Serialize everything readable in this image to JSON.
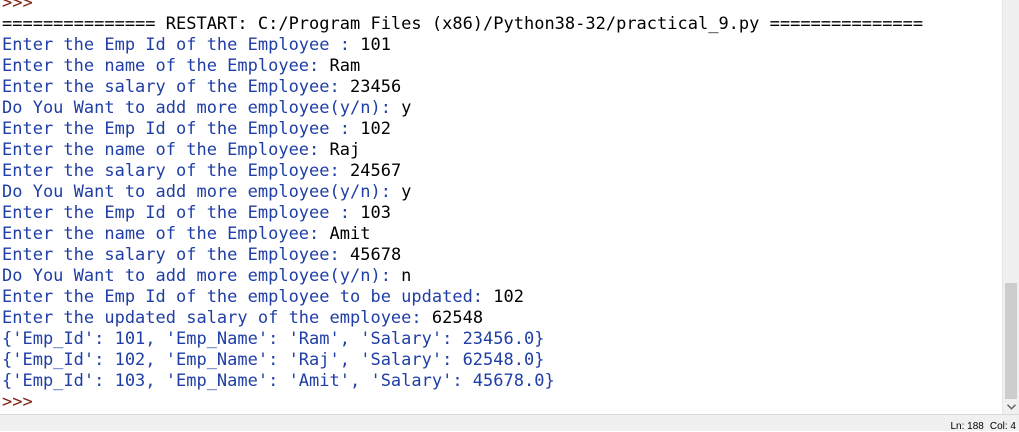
{
  "console": {
    "lines": [
      {
        "kind": "prompt",
        "text": ">>>"
      },
      {
        "kind": "restart",
        "text": "=============== RESTART: C:/Program Files (x86)/Python38-32/practical_9.py ==============="
      },
      {
        "kind": "io",
        "out": "Enter the Emp Id of the Employee : ",
        "in": "101"
      },
      {
        "kind": "io",
        "out": "Enter the name of the Employee: ",
        "in": "Ram"
      },
      {
        "kind": "io",
        "out": "Enter the salary of the Employee: ",
        "in": "23456"
      },
      {
        "kind": "io",
        "out": "Do You Want to add more employee(y/n): ",
        "in": "y"
      },
      {
        "kind": "io",
        "out": "Enter the Emp Id of the Employee : ",
        "in": "102"
      },
      {
        "kind": "io",
        "out": "Enter the name of the Employee: ",
        "in": "Raj"
      },
      {
        "kind": "io",
        "out": "Enter the salary of the Employee: ",
        "in": "24567"
      },
      {
        "kind": "io",
        "out": "Do You Want to add more employee(y/n): ",
        "in": "y"
      },
      {
        "kind": "io",
        "out": "Enter the Emp Id of the Employee : ",
        "in": "103"
      },
      {
        "kind": "io",
        "out": "Enter the name of the Employee: ",
        "in": "Amit"
      },
      {
        "kind": "io",
        "out": "Enter the salary of the Employee: ",
        "in": "45678"
      },
      {
        "kind": "io",
        "out": "Do You Want to add more employee(y/n): ",
        "in": "n"
      },
      {
        "kind": "io",
        "out": "Enter the Emp Id of the employee to be updated: ",
        "in": "102"
      },
      {
        "kind": "io",
        "out": "Enter the updated salary of the employee: ",
        "in": "62548"
      },
      {
        "kind": "out",
        "text": "{'Emp_Id': 101, 'Emp_Name': 'Ram', 'Salary': 23456.0}"
      },
      {
        "kind": "out",
        "text": "{'Emp_Id': 102, 'Emp_Name': 'Raj', 'Salary': 62548.0}"
      },
      {
        "kind": "out",
        "text": "{'Emp_Id': 103, 'Emp_Name': 'Amit', 'Salary': 45678.0}"
      },
      {
        "kind": "prompt",
        "text": ">>>"
      }
    ]
  },
  "statusbar": {
    "line": "Ln: 188",
    "col": "Col: 4"
  },
  "colors": {
    "prompt": "#7f1d0f",
    "stdout": "#1f3ea6",
    "stdin": "#000000"
  }
}
